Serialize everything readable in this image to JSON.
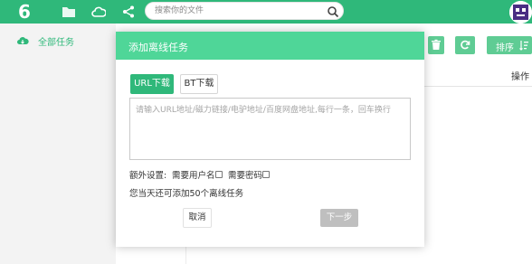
{
  "colors": {
    "brand": "#2fb87a",
    "modal_header": "#4fd698",
    "disabled": "#bfbfbf"
  },
  "topbar": {
    "logo": "6",
    "icons": [
      "folder-icon",
      "cloud-icon",
      "share-icon"
    ],
    "search": {
      "placeholder": "搜索你的文件",
      "icon": "search-icon"
    }
  },
  "sidebar": {
    "items": [
      {
        "label": "全部任务",
        "icon": "cloud-download-icon"
      }
    ]
  },
  "toolbar": {
    "sort_label": "排序",
    "icons": [
      "delete-icon",
      "refresh-icon",
      "sort-icon"
    ]
  },
  "table": {
    "header_ops": "操作"
  },
  "modal": {
    "title": "添加离线任务",
    "tabs": [
      {
        "label": "URL下载",
        "active": true
      },
      {
        "label": "BT下载",
        "active": false
      }
    ],
    "url_input": {
      "value": "",
      "placeholder": "请输入URL地址/磁力链接/电驴地址/百度网盘地址,每行一条，回车换行"
    },
    "extra_label": "额外设置:",
    "options": [
      {
        "label": "需要用户名",
        "checked": false
      },
      {
        "label": "需要密码",
        "checked": false
      }
    ],
    "quota_text": "您当天还可添加50个离线任务",
    "cancel_label": "取消",
    "next_label": "下一步"
  }
}
